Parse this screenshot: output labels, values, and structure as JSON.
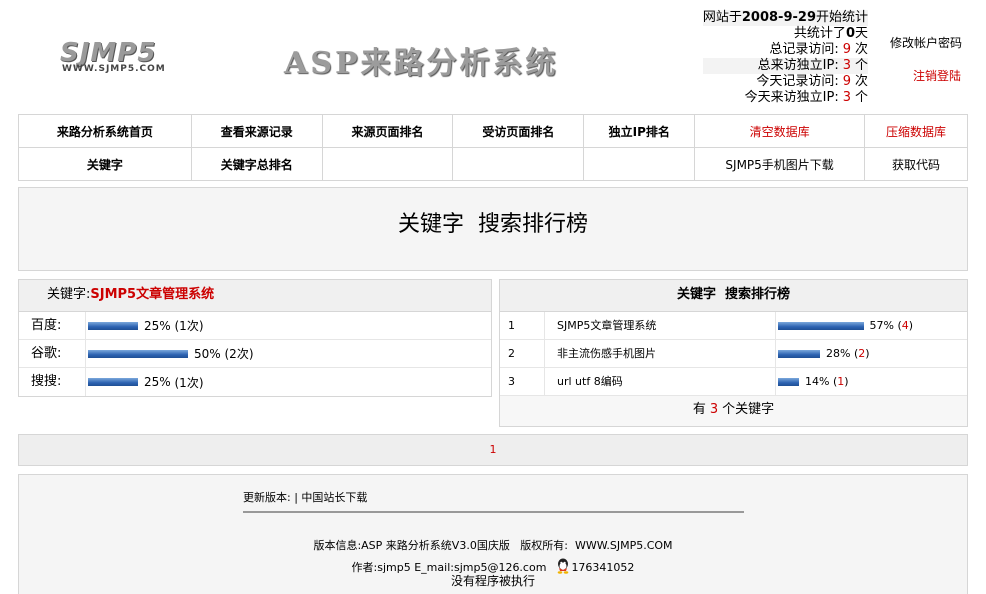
{
  "logo": {
    "name": "SJMP5",
    "url": "WWW.SJMP5.COM"
  },
  "title": "ASP来路分析系统",
  "stats": {
    "start_prefix": "网站于",
    "start_date": "2008-9-29",
    "start_suffix": "开始统计",
    "days_prefix": "共统计了",
    "days": "0",
    "days_suffix": "天",
    "total_visits_label": "总记录访问:",
    "total_visits": "9",
    "total_visits_unit": "次",
    "total_ip_label": "总来访独立IP:",
    "total_ip": "3",
    "total_ip_unit": "个",
    "today_visits_label": "今天记录访问:",
    "today_visits": "9",
    "today_visits_unit": "次",
    "today_ip_label": "今天来访独立IP:",
    "today_ip": "3",
    "today_ip_unit": "个"
  },
  "account": {
    "change_password": "修改帐户密码",
    "logout": "注销登陆"
  },
  "nav": {
    "row1": [
      "来路分析系统首页",
      "查看来源记录",
      "来源页面排名",
      "受访页面排名",
      "独立IP排名",
      "清空数据库",
      "压缩数据库"
    ],
    "row2": [
      "关键字",
      "关键字总排名",
      "",
      "",
      "",
      "SJMP5手机图片下载",
      "获取代码"
    ]
  },
  "banner": {
    "title": "关键字  搜索排行榜"
  },
  "keyword_detail": {
    "label": "关键字:",
    "keyword": "SJMP5文章管理系统",
    "engines": [
      {
        "name": "百度:",
        "percent": 25,
        "text": "25%",
        "count": "(1次)"
      },
      {
        "name": "谷歌:",
        "percent": 50,
        "text": "50%",
        "count": "(2次)"
      },
      {
        "name": "搜搜:",
        "percent": 25,
        "text": "25%",
        "count": "(1次)"
      }
    ]
  },
  "ranking": {
    "title": "关键字  搜索排行榜",
    "rows": [
      {
        "idx": "1",
        "keyword": "SJMP5文章管理系统",
        "percent": 57,
        "text": "57%",
        "count": "4"
      },
      {
        "idx": "2",
        "keyword": "非主流伤感手机图片",
        "percent": 28,
        "text": "28%",
        "count": "2"
      },
      {
        "idx": "3",
        "keyword": "url utf 8编码",
        "percent": 14,
        "text": "14%",
        "count": "1"
      }
    ],
    "total_prefix": "有",
    "total": "3",
    "total_suffix": "个关键字"
  },
  "pager": {
    "current": "1"
  },
  "footer": {
    "update": "更新版本: | 中国站长下载",
    "version": "版本信息:ASP 来路分析系统V3.0国庆版   版权所有:  WWW.SJMP5.COM",
    "author": "作者:sjmp5 E_mail:sjmp5@126.com",
    "qq": "176341052",
    "noexec": "没有程序被执行"
  }
}
